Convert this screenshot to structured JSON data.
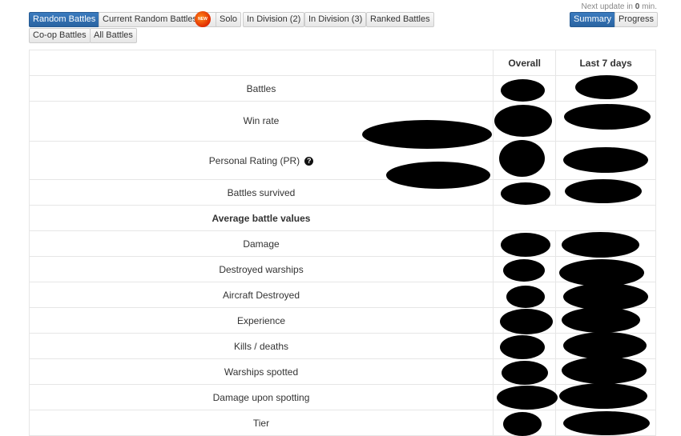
{
  "header": {
    "next_update_prefix": "Next update in ",
    "next_update_value": "0",
    "next_update_suffix": " min."
  },
  "mode_tabs": [
    {
      "label": "Random Battles",
      "active": true
    },
    {
      "label": "Current Random Battles",
      "badge": "NEW"
    },
    {
      "label": "Solo"
    },
    {
      "label": "In Division (2)"
    },
    {
      "label": "In Division (3)"
    },
    {
      "label": "Ranked Battles"
    },
    {
      "label": "Co-op Battles"
    },
    {
      "label": "All Battles"
    }
  ],
  "view_tabs": [
    {
      "label": "Summary",
      "active": true
    },
    {
      "label": "Progress"
    }
  ],
  "table": {
    "headers": [
      "",
      "Overall",
      "Last 7 days"
    ],
    "rows": [
      {
        "label": "Battles",
        "overall": "[redacted]",
        "last7": "[redacted]"
      },
      {
        "label": "Win rate",
        "overall": "[redacted]",
        "last7": "[redacted]"
      },
      {
        "label": "Personal Rating (PR)",
        "help_icon": true,
        "overall": "[redacted]",
        "last7": "[redacted]"
      },
      {
        "label": "Battles survived",
        "overall": "[redacted]",
        "last7": "[redacted]"
      },
      {
        "label": "Average battle values",
        "section": true
      },
      {
        "label": "Damage",
        "overall": "[redacted]",
        "last7": "[redacted]"
      },
      {
        "label": "Destroyed warships",
        "overall": "[redacted]",
        "last7": "[redacted]"
      },
      {
        "label": "Aircraft Destroyed",
        "overall": "[redacted]",
        "last7": "[redacted]"
      },
      {
        "label": "Experience",
        "overall": "[redacted]",
        "last7": "[redacted]"
      },
      {
        "label": "Kills / deaths",
        "overall": "[redacted]",
        "last7": "[redacted]"
      },
      {
        "label": "Warships spotted",
        "overall": "[redacted]",
        "last7": "[redacted]"
      },
      {
        "label": "Damage upon spotting",
        "overall": "[redacted]",
        "last7": "[redacted]"
      },
      {
        "label": "Tier",
        "overall": "[redacted]",
        "last7": "[redacted]"
      }
    ]
  }
}
